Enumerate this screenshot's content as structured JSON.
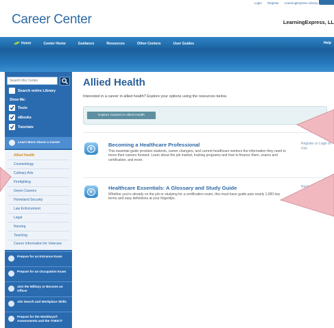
{
  "header": {
    "top_links": [
      "Login",
      "Register",
      "LearningExpress Library",
      "Contact"
    ],
    "title": "Career Center",
    "brand": "LearningExpress, LL"
  },
  "nav": {
    "items": [
      "Home",
      "Center Home",
      "Guidance",
      "Resources",
      "Other Centers",
      "User Guides"
    ],
    "help": "Help"
  },
  "sidebar": {
    "search_placeholder": "Search this Center",
    "search_all": "Search entire Library",
    "show_me": "Show Me:",
    "filters": [
      "Tests",
      "eBooks",
      "Tutorials"
    ],
    "learn_more": "Learn More About a Career",
    "careers": [
      "Allied Health",
      "Cosmetology",
      "Culinary Arts",
      "Firefighting",
      "Green Careers",
      "Homeland Security",
      "Law Enforcement",
      "Legal",
      "Nursing",
      "Teaching",
      "Career Information for Veterans"
    ],
    "active_career": "Allied Health",
    "sections": [
      "Prepare for an Entrance Exam",
      "Prepare for an Occupation Exam",
      "Join the Military or Become an Officer",
      "Job Search and Workplace Skills",
      "Prepare for the Workkeys® Assessments and the TOEIC®"
    ]
  },
  "main": {
    "title": "Allied Health",
    "intro": "Interested in a career in allied health? Explore your options using the resources below.",
    "explore_button": "Explore Careers in Allied Health",
    "resources": [
      {
        "title": "Becoming a Healthcare Professional",
        "description": "This essential guide provides students, career changers, and current healthcare workers the information they need to move their careers forward. Learn about the job market, training programs and how to finance them, exams and certification, and more.",
        "register_text": "Register or Login to Use"
      },
      {
        "title": "Healthcare Essentials: A Glossary and Study Guide",
        "description": "Whether you're already on the job or studying for a certification exam, this must-have guide puts nearly 1,000 key terms and easy definitions at your fingertips.",
        "register_text": "Register or Login to Use"
      }
    ]
  },
  "colors": {
    "brand_blue": "#2c6aa3",
    "sidebar_blue": "#2a6bb0",
    "active_orange": "#d48a17",
    "callout_pink": "#f2b8c0"
  },
  "icons": [
    "search-icon",
    "checkbox-icon",
    "ebook-icon",
    "callout-arrow"
  ]
}
